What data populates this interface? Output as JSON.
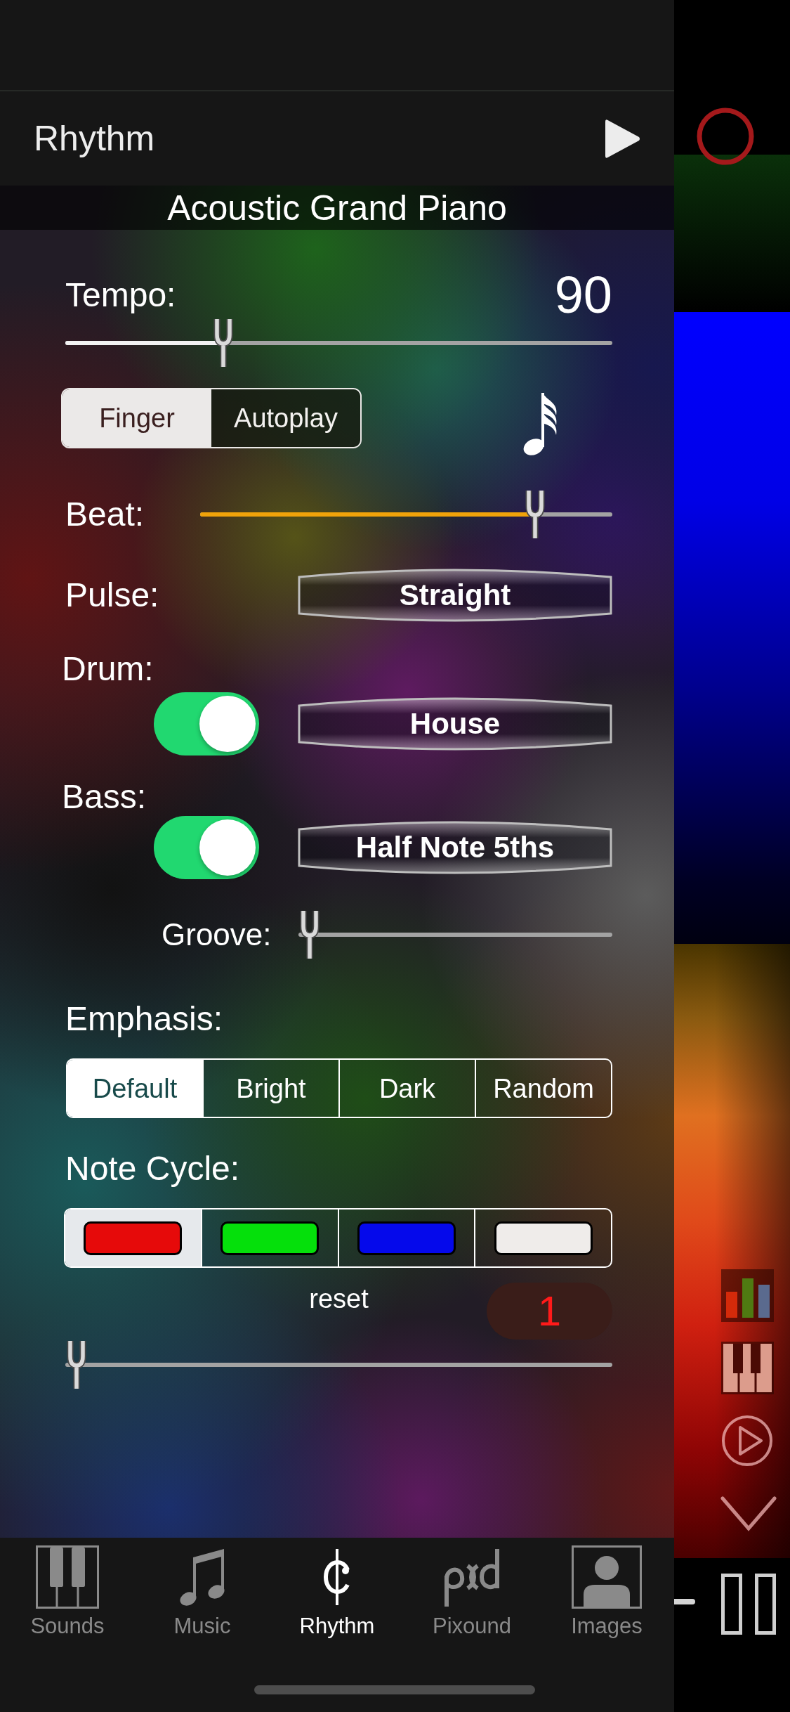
{
  "header": {
    "title": "Rhythm",
    "instrument": "Acoustic Grand Piano"
  },
  "tempo": {
    "label": "Tempo:",
    "value": "90",
    "level": 0.28
  },
  "play_mode": {
    "options": [
      {
        "label": "Finger",
        "selected": true
      },
      {
        "label": "Autoplay",
        "selected": false
      }
    ]
  },
  "beat": {
    "label": "Beat:",
    "level": 0.83
  },
  "pulse": {
    "label": "Pulse:",
    "button": "Straight"
  },
  "drum": {
    "label": "Drum:",
    "on": true,
    "button": "House"
  },
  "bass": {
    "label": "Bass:",
    "on": true,
    "button": "Half Note 5ths"
  },
  "groove": {
    "label": "Groove:",
    "level": 0
  },
  "emphasis": {
    "label": "Emphasis:",
    "options": [
      {
        "label": "Default",
        "selected": true
      },
      {
        "label": "Bright",
        "selected": false
      },
      {
        "label": "Dark",
        "selected": false
      },
      {
        "label": "Random",
        "selected": false
      }
    ]
  },
  "note_cycle": {
    "label": "Note Cycle:",
    "options": [
      {
        "color": "#e60a0a",
        "selected": true
      },
      {
        "color": "#05e00b",
        "selected": false
      },
      {
        "color": "#0509eb",
        "selected": false
      },
      {
        "color": "#efecea",
        "selected": false
      }
    ],
    "reset": "reset",
    "count": "1",
    "level": 0
  },
  "tab_bar": {
    "tabs": [
      {
        "label": "Sounds",
        "selected": false
      },
      {
        "label": "Music",
        "selected": false
      },
      {
        "label": "Rhythm",
        "selected": true
      },
      {
        "label": "Pixound",
        "selected": false
      },
      {
        "label": "Images",
        "selected": false
      }
    ]
  }
}
